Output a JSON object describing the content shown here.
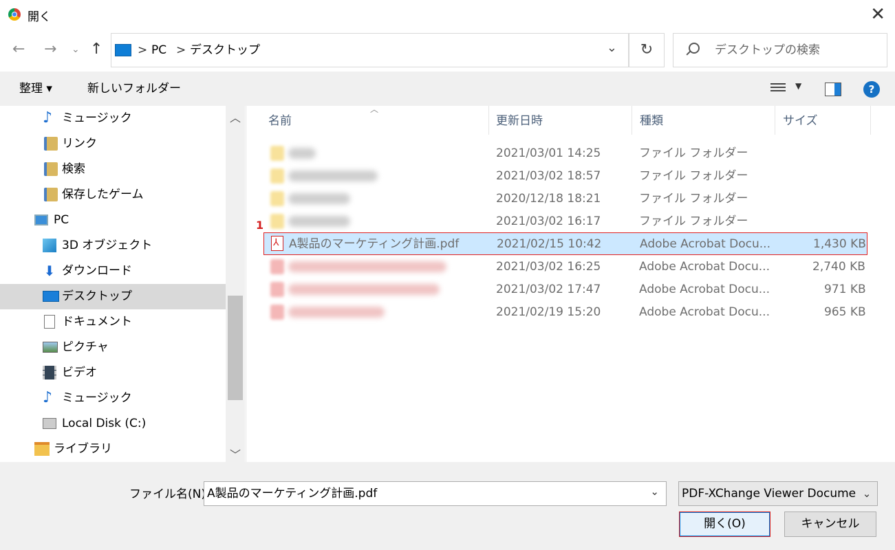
{
  "window": {
    "title": "開く",
    "close_icon": "close-icon",
    "app_icon": "chrome-icon"
  },
  "addressbar": {
    "crumbs": [
      "PC",
      "デスクトップ"
    ],
    "separator": ">",
    "search_placeholder": "デスクトップの検索"
  },
  "toolbar": {
    "organize_label": "整理 ▾",
    "new_folder_label": "新しいフォルダー"
  },
  "sidebar": {
    "items": [
      {
        "label": "ミュージック",
        "icon": "music-icon"
      },
      {
        "label": "リンク",
        "icon": "link-folder-icon"
      },
      {
        "label": "検索",
        "icon": "search-folder-icon"
      },
      {
        "label": "保存したゲーム",
        "icon": "saved-games-icon"
      },
      {
        "label": "PC",
        "icon": "pc-icon"
      },
      {
        "label": "3D オブジェクト",
        "icon": "3d-objects-icon"
      },
      {
        "label": "ダウンロード",
        "icon": "download-icon"
      },
      {
        "label": "デスクトップ",
        "icon": "desktop-icon",
        "selected": true
      },
      {
        "label": "ドキュメント",
        "icon": "documents-icon"
      },
      {
        "label": "ピクチャ",
        "icon": "pictures-icon"
      },
      {
        "label": "ビデオ",
        "icon": "videos-icon"
      },
      {
        "label": "ミュージック",
        "icon": "music-icon"
      },
      {
        "label": "Local Disk (C:)",
        "icon": "disk-icon"
      },
      {
        "label": "ライブラリ",
        "icon": "library-icon"
      }
    ]
  },
  "list": {
    "columns": [
      "名前",
      "更新日時",
      "種類",
      "サイズ"
    ],
    "rows": [
      {
        "name": "",
        "date": "2021/03/01 14:25",
        "type": "ファイル フォルダー",
        "size": "",
        "kind": "folder"
      },
      {
        "name": "",
        "date": "2021/03/02 18:57",
        "type": "ファイル フォルダー",
        "size": "",
        "kind": "folder"
      },
      {
        "name": "",
        "date": "2020/12/18 18:21",
        "type": "ファイル フォルダー",
        "size": "",
        "kind": "folder"
      },
      {
        "name": "",
        "date": "2021/03/02 16:17",
        "type": "ファイル フォルダー",
        "size": "",
        "kind": "folder"
      },
      {
        "name": "A製品のマーケティング計画.pdf",
        "date": "2021/02/15 10:42",
        "type": "Adobe Acrobat Docu...",
        "size": "1,430 KB",
        "kind": "pdf",
        "selected": true
      },
      {
        "name": "",
        "date": "2021/03/02 16:25",
        "type": "Adobe Acrobat Docu...",
        "size": "2,740 KB",
        "kind": "pdf"
      },
      {
        "name": "",
        "date": "2021/03/02 17:47",
        "type": "Adobe Acrobat Docu...",
        "size": "971 KB",
        "kind": "pdf"
      },
      {
        "name": "",
        "date": "2021/02/19 15:20",
        "type": "Adobe Acrobat Docu...",
        "size": "965 KB",
        "kind": "pdf"
      }
    ],
    "step_marker": "1"
  },
  "bottom": {
    "filename_label": "ファイル名(N):",
    "filename_value": "A製品のマーケティング計画.pdf",
    "filetype_value": "PDF-XChange Viewer Documen",
    "open_label": "開く(O)",
    "cancel_label": "キャンセル"
  },
  "colors": {
    "accent": "#0078d7",
    "selection": "#cce8ff",
    "highlight_border": "#d42020"
  }
}
